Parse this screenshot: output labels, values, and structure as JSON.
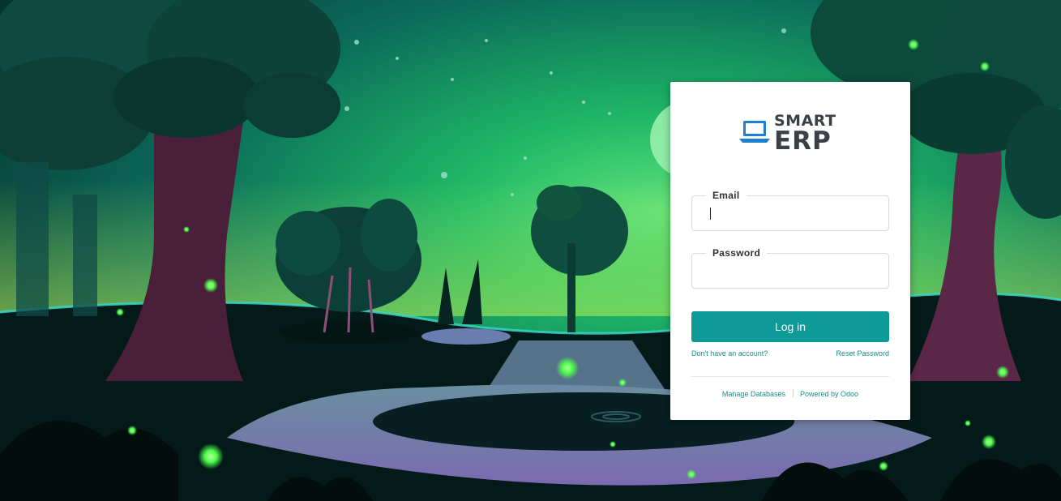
{
  "colors": {
    "accent": "#0e9a96",
    "link": "#178f8c",
    "logo_text": "#3b3f46",
    "logo_icon": "#1f7fd0",
    "firefly": "#4dff4d"
  },
  "logo": {
    "line1": "SMART",
    "line2": "ERP",
    "icon": "laptop-icon"
  },
  "form": {
    "email_label": "Email",
    "email_value": "",
    "password_label": "Password",
    "password_value": "",
    "login_label": "Log in",
    "signup_link": "Don't have an account?",
    "reset_link": "Reset Password"
  },
  "footer": {
    "manage_databases": "Manage Databases",
    "powered_by": "Powered by Odoo"
  }
}
